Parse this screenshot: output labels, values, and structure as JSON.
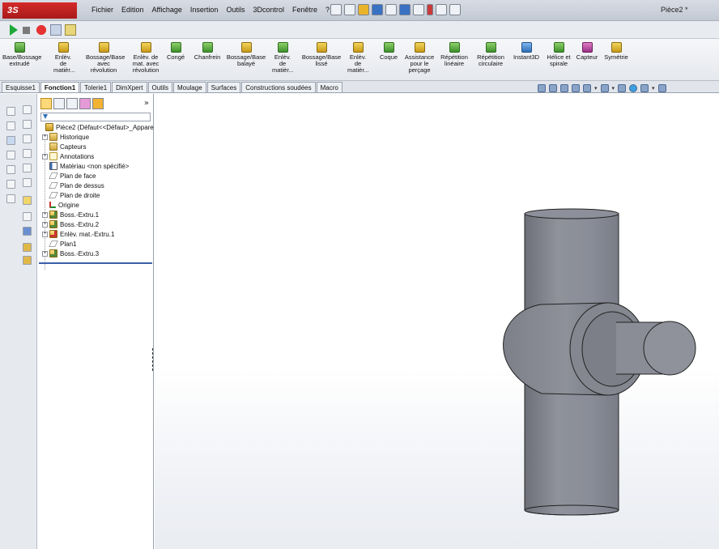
{
  "app": {
    "logo_text": "3S SOLIDWORKS",
    "doc_title": "Pièce2 *"
  },
  "menu": [
    "Fichier",
    "Edition",
    "Affichage",
    "Insertion",
    "Outils",
    "3Dcontrol",
    "Fenêtre",
    "?"
  ],
  "ribbon": [
    {
      "label": "Base/Bossage\nextrudé",
      "icon": "extrude-boss-icon"
    },
    {
      "label": "Enlèv.\nde\nmatièr...",
      "icon": "extrude-cut-icon"
    },
    {
      "label": "Bossage/Base\navec\nrévolution",
      "icon": "revolve-boss-icon"
    },
    {
      "label": "Enlèv. de\nmat. avec\nrévolution",
      "icon": "revolve-cut-icon"
    },
    {
      "label": "Congé",
      "icon": "fillet-icon"
    },
    {
      "label": "Chanfrein",
      "icon": "chamfer-icon"
    },
    {
      "label": "Bossage/Base\nbalayé",
      "icon": "sweep-boss-icon"
    },
    {
      "label": "Enlèv.\nde\nmatièr...",
      "icon": "sweep-cut-icon"
    },
    {
      "label": "Bossage/Base\nlissé",
      "icon": "loft-boss-icon"
    },
    {
      "label": "Enlèv.\nde\nmatièr...",
      "icon": "loft-cut-icon"
    },
    {
      "label": "Coque",
      "icon": "shell-icon"
    },
    {
      "label": "Assistance\npour le\nperçage",
      "icon": "hole-wizard-icon"
    },
    {
      "label": "Répétition\nlinéaire",
      "icon": "linear-pattern-icon"
    },
    {
      "label": "Répétition\ncirculaire",
      "icon": "circular-pattern-icon"
    },
    {
      "label": "Instant3D",
      "icon": "instant3d-icon"
    },
    {
      "label": "Hélice et\nspirale",
      "icon": "helix-icon"
    },
    {
      "label": "Capteur",
      "icon": "sensor-icon"
    },
    {
      "label": "Symétrie",
      "icon": "mirror-icon"
    }
  ],
  "tabs": [
    "Esquisse1",
    "Fonction1",
    "Tolerie1",
    "DimXpert",
    "Outils",
    "Moulage",
    "Surfaces",
    "Constructions soudées",
    "Macro"
  ],
  "active_tab": "Fonction1",
  "tree": {
    "root": "Pièce2  (Défaut<<Défaut>_Appare",
    "items": [
      {
        "label": "Historique",
        "icon": "folder-icon",
        "expandable": true
      },
      {
        "label": "Capteurs",
        "icon": "sensor-folder-icon",
        "expandable": false
      },
      {
        "label": "Annotations",
        "icon": "annotation-icon",
        "expandable": true
      },
      {
        "label": "Matériau <non spécifié>",
        "icon": "material-icon",
        "expandable": false
      },
      {
        "label": "Plan de face",
        "icon": "plane-icon",
        "expandable": false
      },
      {
        "label": "Plan de dessus",
        "icon": "plane-icon",
        "expandable": false
      },
      {
        "label": "Plan de droite",
        "icon": "plane-icon",
        "expandable": false
      },
      {
        "label": "Origine",
        "icon": "origin-icon",
        "expandable": false
      },
      {
        "label": "Boss.-Extru.1",
        "icon": "boss-extrude-icon",
        "expandable": true
      },
      {
        "label": "Boss.-Extru.2",
        "icon": "boss-extrude-icon",
        "expandable": true
      },
      {
        "label": "Enlèv. mat.-Extru.1",
        "icon": "cut-extrude-icon",
        "expandable": true
      },
      {
        "label": "Plan1",
        "icon": "plane-icon",
        "expandable": false
      },
      {
        "label": "Boss.-Extru.3",
        "icon": "boss-extrude-icon",
        "expandable": true
      }
    ]
  },
  "colors": {
    "model_fill": "#8a8d97",
    "model_dark": "#6e7079",
    "model_light": "#a9acb4",
    "menu_red": "#c42222"
  }
}
